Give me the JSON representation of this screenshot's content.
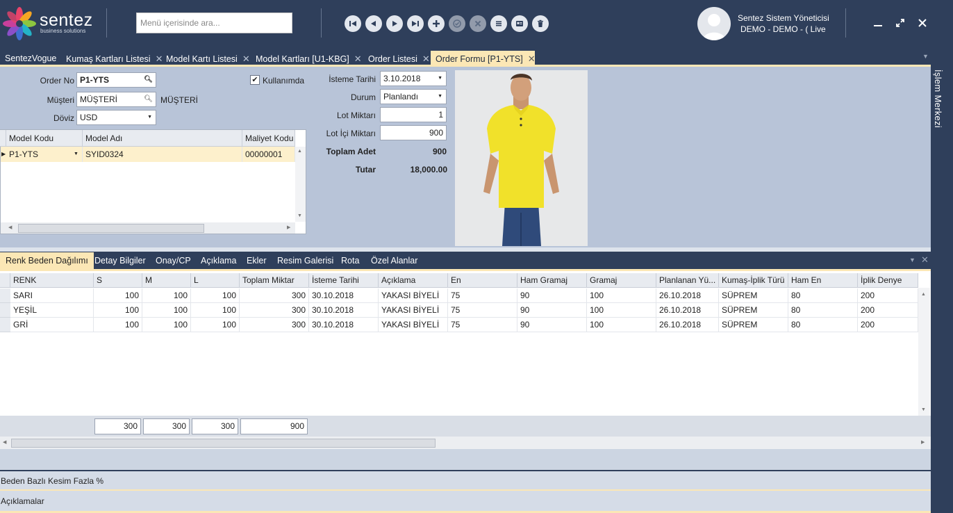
{
  "brand": {
    "name": "sentez",
    "tagline": "business solutions"
  },
  "search": {
    "placeholder": "Menü içerisinde ara..."
  },
  "user": {
    "name": "Sentez Sistem Yöneticisi",
    "env": "DEMO - DEMO - ( Live"
  },
  "tabs": [
    {
      "label": "SentezVogue",
      "closable": false
    },
    {
      "label": "Kumaş Kartları Listesi",
      "closable": true
    },
    {
      "label": "Model Kartı Listesi",
      "closable": true
    },
    {
      "label": "Model Kartları [U1-KBG]",
      "closable": true
    },
    {
      "label": "Order Listesi",
      "closable": true
    },
    {
      "label": "Order Formu [P1-YTS]",
      "closable": true,
      "active": true
    }
  ],
  "side_panel": "İşlem Merkezi",
  "form": {
    "order_no_label": "Order No",
    "order_no": "P1-YTS",
    "musteri_label": "Müşteri",
    "musteri": "MÜŞTERİ",
    "musteri_name": "MÜŞTERİ",
    "doviz_label": "Döviz",
    "doviz": "USD",
    "kullanimda_label": "Kullanımda",
    "kullanimda": true,
    "istemetarihi_label": "İsteme Tarihi",
    "istemetarihi": "3.10.2018",
    "durum_label": "Durum",
    "durum": "Planlandı",
    "lot_miktari_label": "Lot Miktarı",
    "lot_miktari": "1",
    "lot_ici_label": "Lot İçi Miktarı",
    "lot_ici": "900",
    "toplam_adet_label": "Toplam Adet",
    "toplam_adet": "900",
    "tutar_label": "Tutar",
    "tutar": "18,000.00"
  },
  "model_grid": {
    "headers": [
      "Model Kodu",
      "Model Adı",
      "Maliyet Kodu"
    ],
    "rows": [
      [
        "P1-YTS",
        "SYID0324",
        "00000001"
      ]
    ]
  },
  "bottom_tabs": [
    "Renk Beden Dağılımı",
    "Detay Bilgiler",
    "Onay/CP",
    "Açıklama",
    "Ekler",
    "Resim Galerisi",
    "Rota",
    "Özel Alanlar"
  ],
  "grid": {
    "headers": [
      "RENK",
      "S",
      "M",
      "L",
      "Toplam Miktar",
      "İsteme Tarihi",
      "Açıklama",
      "En",
      "Ham Gramaj",
      "Gramaj",
      "Planlanan Yü...",
      "Kumaş-İplik Türü",
      "Ham En",
      "İplik Denye"
    ],
    "rows": [
      [
        "SARI",
        "100",
        "100",
        "100",
        "300",
        "30.10.2018",
        "YAKASI BİYELİ",
        "75",
        "90",
        "100",
        "26.10.2018",
        "SÜPREM",
        "80",
        "200"
      ],
      [
        "YEŞİL",
        "100",
        "100",
        "100",
        "300",
        "30.10.2018",
        "YAKASI BİYELİ",
        "75",
        "90",
        "100",
        "26.10.2018",
        "SÜPREM",
        "80",
        "200"
      ],
      [
        "GRİ",
        "100",
        "100",
        "100",
        "300",
        "30.10.2018",
        "YAKASI BİYELİ",
        "75",
        "90",
        "100",
        "26.10.2018",
        "SÜPREM",
        "80",
        "200"
      ]
    ],
    "totals": [
      "300",
      "300",
      "300",
      "900"
    ]
  },
  "sections": {
    "beden": "Beden Bazlı Kesim Fazla %",
    "aciklamalar": "Açıklamalar"
  },
  "colors": {
    "header": "#2f3f5b",
    "accent": "#fbe7b5",
    "form_bg": "#b8c4d8"
  }
}
